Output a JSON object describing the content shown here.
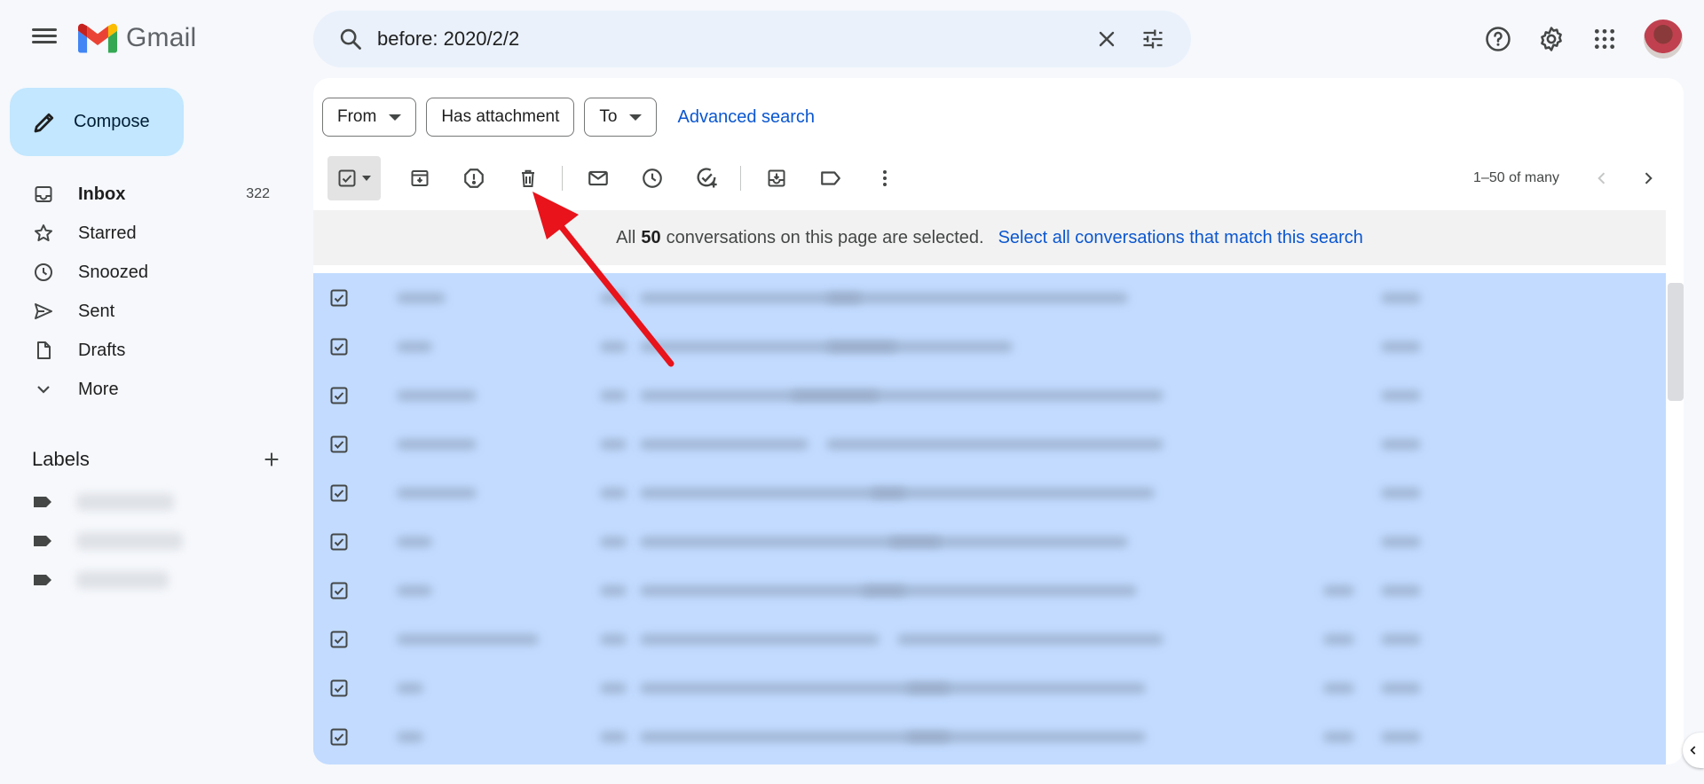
{
  "app": {
    "brand": "Gmail"
  },
  "search": {
    "query": "before: 2020/2/2"
  },
  "compose": {
    "label": "Compose"
  },
  "nav": [
    {
      "label": "Inbox",
      "count": "322",
      "icon": "inbox-icon",
      "bold": true
    },
    {
      "label": "Starred",
      "count": "",
      "icon": "star-icon"
    },
    {
      "label": "Snoozed",
      "count": "",
      "icon": "clock-icon"
    },
    {
      "label": "Sent",
      "count": "",
      "icon": "send-icon"
    },
    {
      "label": "Drafts",
      "count": "",
      "icon": "draft-icon"
    },
    {
      "label": "More",
      "count": "",
      "icon": "chevron-down-icon"
    }
  ],
  "labels": {
    "title": "Labels"
  },
  "filters": {
    "from": "From",
    "attachment": "Has attachment",
    "to": "To",
    "advanced": "Advanced search"
  },
  "pager": {
    "text": "1–50 of many"
  },
  "banner": {
    "prefix": "All",
    "count": "50",
    "suffix": "conversations on this page are selected.",
    "link": "Select all conversations that match this search"
  },
  "colors": {
    "accent": "#0b57d0",
    "selected_row": "#c2dbff",
    "compose_bg": "#c2e7ff",
    "annotation_arrow": "#e8131b"
  }
}
